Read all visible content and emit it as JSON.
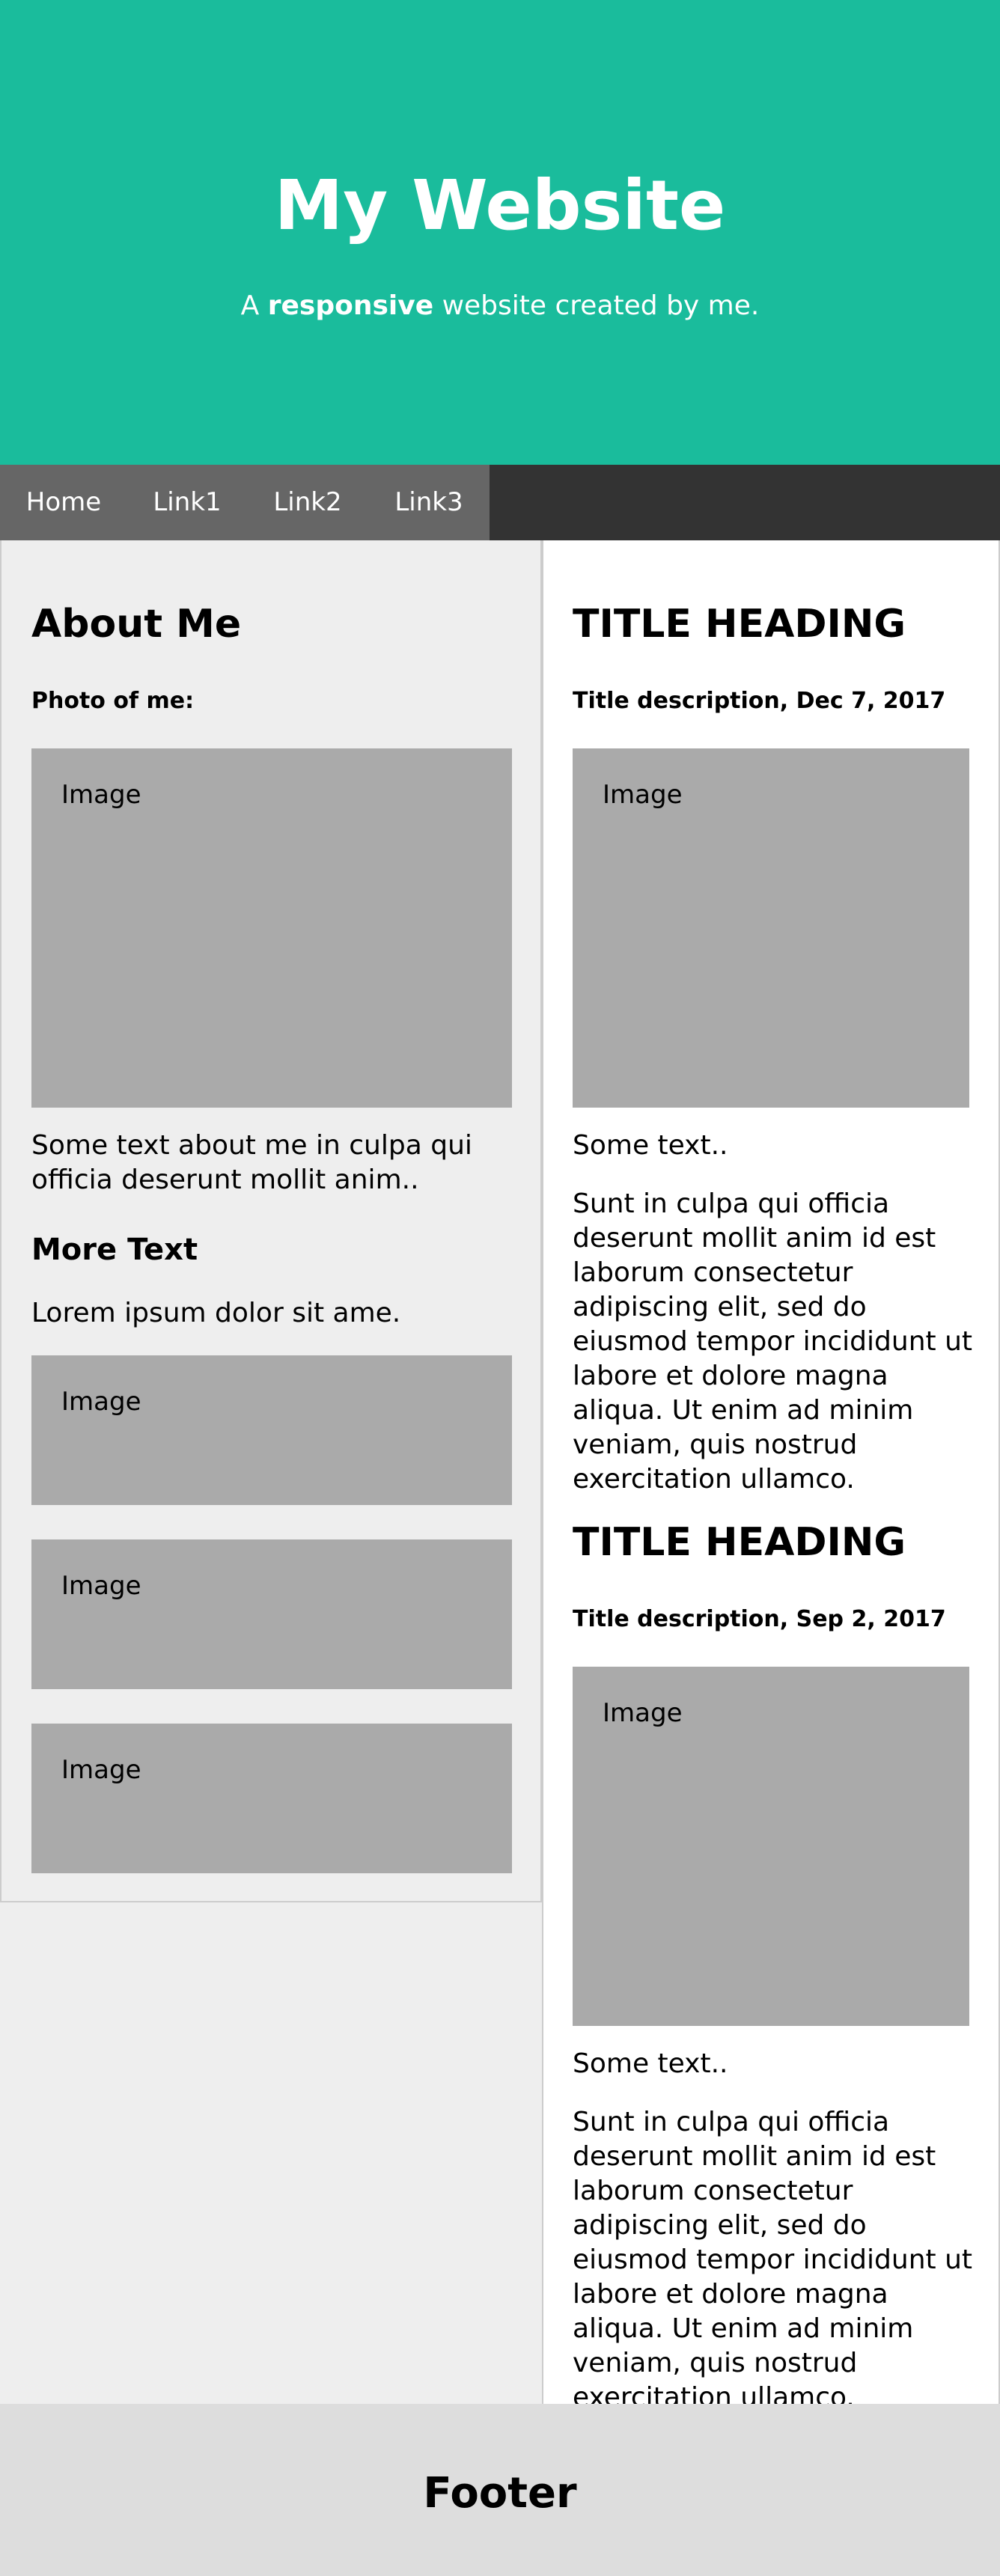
{
  "header": {
    "title": "My Website",
    "subtitle_prefix": "A ",
    "subtitle_bold": "responsive",
    "subtitle_suffix": " website created by me."
  },
  "nav": {
    "items": [
      {
        "label": "Home"
      },
      {
        "label": "Link1"
      },
      {
        "label": "Link2"
      },
      {
        "label": "Link3"
      }
    ]
  },
  "side": {
    "heading": "About Me",
    "photo_label": "Photo of me:",
    "image_label": "Image",
    "about_text": "Some text about me in culpa qui officia deserunt mollit anim..",
    "more_heading": "More Text",
    "more_text": "Lorem ipsum dolor sit ame.",
    "small_images": [
      "Image",
      "Image",
      "Image"
    ]
  },
  "main": {
    "posts": [
      {
        "title": "TITLE HEADING",
        "description": "Title description, Dec 7, 2017",
        "image_label": "Image",
        "short_text": "Some text..",
        "body": "Sunt in culpa qui officia deserunt mollit anim id est laborum consectetur adipiscing elit, sed do eiusmod tempor incididunt ut labore et dolore magna aliqua. Ut enim ad minim veniam, quis nostrud exercitation ullamco."
      },
      {
        "title": "TITLE HEADING",
        "description": "Title description, Sep 2, 2017",
        "image_label": "Image",
        "short_text": "Some text..",
        "body": "Sunt in culpa qui officia deserunt mollit anim id est laborum consectetur adipiscing elit, sed do eiusmod tempor incididunt ut labore et dolore magna aliqua. Ut enim ad minim veniam, quis nostrud exercitation ullamco."
      }
    ]
  },
  "footer": {
    "title": "Footer"
  },
  "colors": {
    "header_bg": "#1abc9c",
    "navbar_bg": "#333333",
    "nav_active_bg": "#666666",
    "side_bg": "#eeeeee",
    "image_bg": "#aaaaaa",
    "footer_bg": "#dddddd"
  }
}
